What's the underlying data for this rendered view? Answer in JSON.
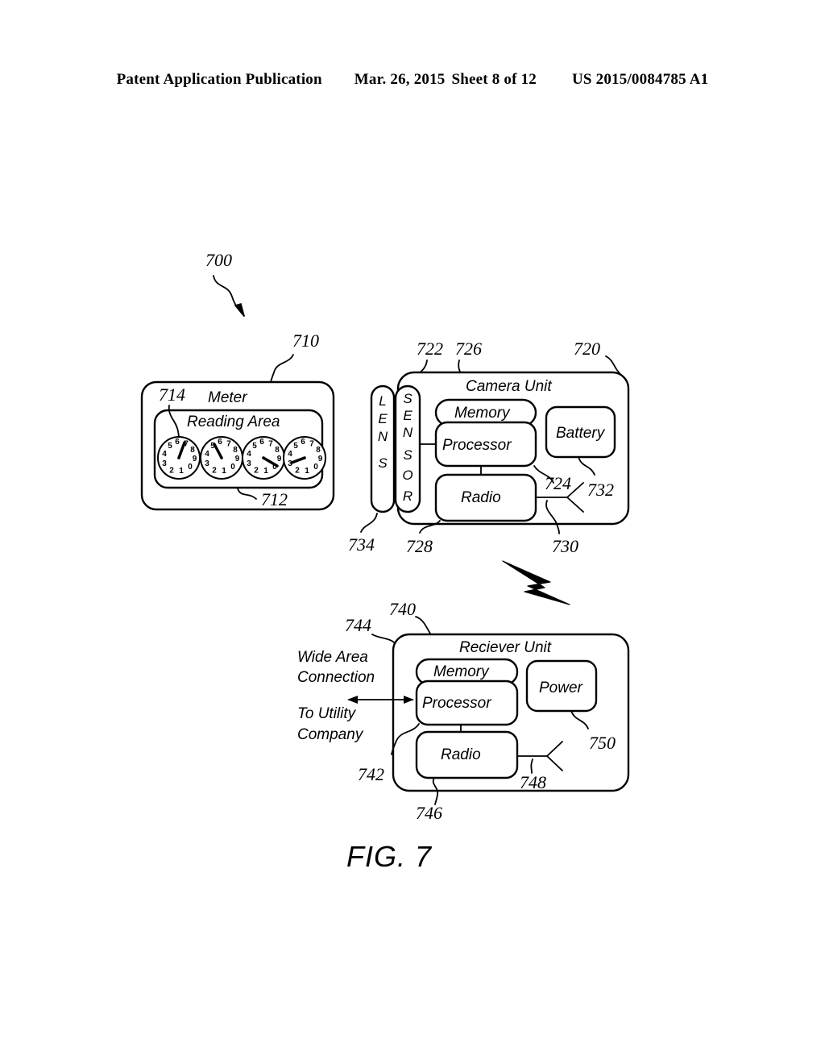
{
  "header": {
    "publication": "Patent Application Publication",
    "date": "Mar. 26, 2015",
    "sheet": "Sheet 8 of 12",
    "patent_number": "US 2015/0084785 A1"
  },
  "figure": {
    "name": "FIG. 7",
    "system_ref": "700"
  },
  "meter": {
    "ref": "710",
    "title": "Meter",
    "reading_area": {
      "ref": "712",
      "title": "Reading Area"
    },
    "dial_ref": "714",
    "dial_digits": [
      "0",
      "1",
      "2",
      "3",
      "4",
      "5",
      "6",
      "7",
      "8",
      "9"
    ],
    "dials": [
      {
        "name": "dial-1",
        "hand_angle_deg": 20
      },
      {
        "name": "dial-2",
        "hand_angle_deg": -28
      },
      {
        "name": "dial-3",
        "hand_angle_deg": 118
      },
      {
        "name": "dial-4",
        "hand_angle_deg": 78
      }
    ]
  },
  "camera_unit": {
    "ref": "720",
    "title": "Camera Unit",
    "lens": {
      "label": "LENS",
      "ref": "734"
    },
    "sensor": {
      "label": "SENSOR",
      "ref": "722"
    },
    "memory": {
      "label": "Memory",
      "ref": "726"
    },
    "processor": {
      "label": "Processor",
      "ref": "728"
    },
    "radio": {
      "label": "Radio",
      "ref": "730"
    },
    "antenna": {
      "ref": "724"
    },
    "battery": {
      "label": "Battery",
      "ref": "732"
    }
  },
  "receiver_unit": {
    "ref": "740",
    "title": "Reciever Unit",
    "memory": {
      "label": "Memory",
      "ref": "744"
    },
    "processor": {
      "label": "Processor",
      "ref": "742"
    },
    "radio": {
      "label": "Radio",
      "ref": "746"
    },
    "antenna": {
      "ref": "748"
    },
    "power": {
      "label": "Power",
      "ref": "750"
    },
    "wide_area_line1": "Wide Area",
    "wide_area_line2": "Connection",
    "utility_line1": "To Utility",
    "utility_line2": "Company"
  },
  "wireless_link": {
    "name": "lightning-bolt"
  },
  "colors": {
    "ink": "#000000",
    "paper": "#ffffff"
  }
}
